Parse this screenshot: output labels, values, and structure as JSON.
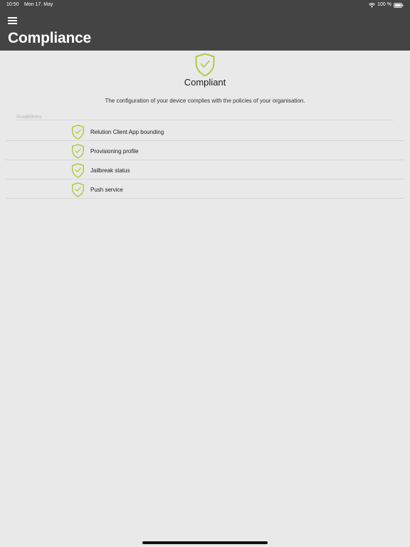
{
  "status_bar": {
    "time": "10:50",
    "date": "Mon 17. May",
    "battery": "100 %",
    "icons": [
      "wifi-icon",
      "battery-icon"
    ]
  },
  "navbar": {
    "title": "Compliance",
    "menu_icon": "hamburger-menu-icon"
  },
  "compliance": {
    "status_icon": "shield-check-icon",
    "status": "Compliant",
    "description": "The configuration of your device complies with the policies of your organisation."
  },
  "guidelines": {
    "section_label": "Guidelines",
    "items": [
      {
        "label": "Relution Client App bounding",
        "icon": "shield-check-icon"
      },
      {
        "label": "Provisioning profile",
        "icon": "shield-check-icon"
      },
      {
        "label": "Jailbreak status",
        "icon": "shield-check-icon"
      },
      {
        "label": "Push service",
        "icon": "shield-check-icon"
      }
    ]
  },
  "colors": {
    "header_bg": "#444444",
    "page_bg": "#e9e9e9",
    "accent_shield": "#a8c932"
  }
}
